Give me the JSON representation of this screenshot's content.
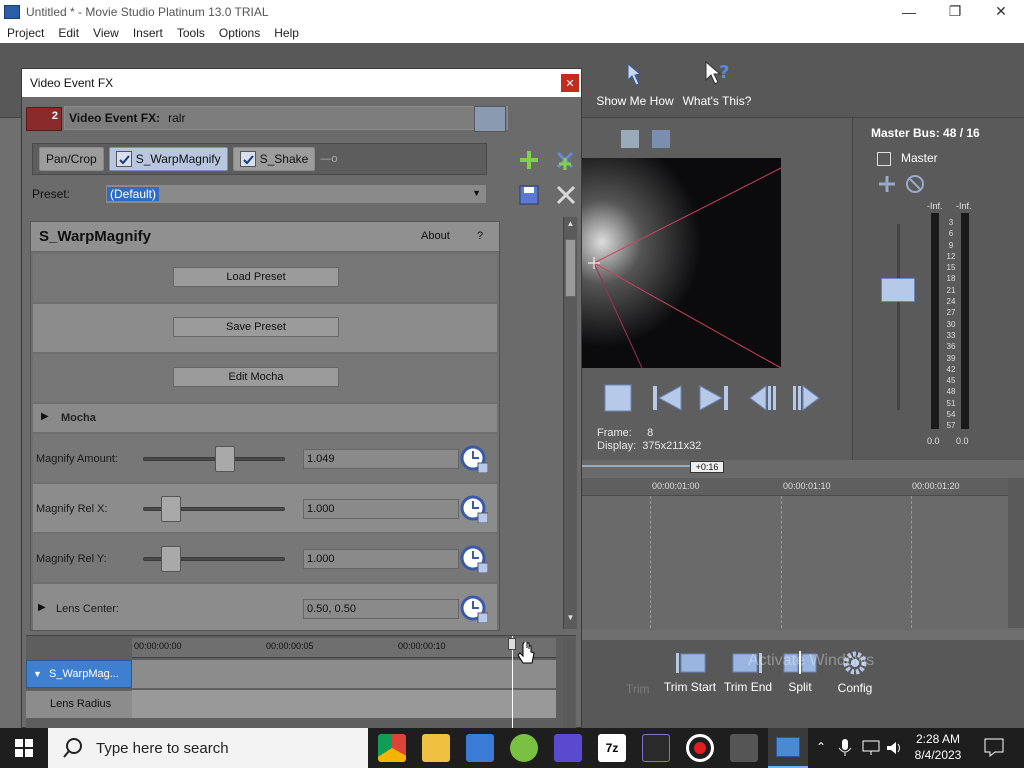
{
  "window": {
    "title": "Untitled * - Movie Studio Platinum 13.0 TRIAL"
  },
  "menu": [
    "Project",
    "Edit",
    "View",
    "Insert",
    "Tools",
    "Options",
    "Help"
  ],
  "toolbar": {
    "show_me_how": "Show Me How",
    "whats_this": "What's This?"
  },
  "preview": {
    "frame_label": "Frame:",
    "frame_value": "8",
    "display_label": "Display:",
    "display_value": "375x211x32"
  },
  "master": {
    "title": "Master Bus:",
    "counts": "48 / 16",
    "label": "Master",
    "peak_left": "-Inf.",
    "peak_right": "-Inf.",
    "scale": [
      "3",
      "6",
      "9",
      "12",
      "15",
      "18",
      "21",
      "24",
      "27",
      "30",
      "33",
      "36",
      "39",
      "42",
      "45",
      "48",
      "51",
      "54",
      "57"
    ],
    "floor_left": "0.0",
    "floor_right": "0.0"
  },
  "timeline": {
    "offset": "+0:16",
    "marks": [
      "00:00:01:00",
      "00:00:01:10",
      "00:00:01:20"
    ]
  },
  "dialog": {
    "title": "Video Event FX",
    "badge": "2",
    "header_label": "Video Event FX:",
    "header_value": "ralr",
    "chain": [
      "Pan/Crop",
      "S_WarpMagnify",
      "S_Shake"
    ],
    "preset_label": "Preset:",
    "preset_value": "(Default)",
    "plugin_name": "S_WarpMagnify",
    "about": "About",
    "help": "?",
    "buttons": [
      "Load Preset",
      "Save Preset",
      "Edit Mocha"
    ],
    "mocha": "Mocha",
    "params": [
      {
        "label": "Magnify Amount:",
        "value": "1.049",
        "slider": 0.58
      },
      {
        "label": "Magnify Rel X:",
        "value": "1.000",
        "slider": 0.2
      },
      {
        "label": "Magnify Rel Y:",
        "value": "1.000",
        "slider": 0.2
      }
    ],
    "lens_center_label": "Lens Center:",
    "lens_center_value": "0.50, 0.50",
    "kf_ruler": [
      "00:00:00:00",
      "00:00:00:05",
      "00:00:00:10"
    ],
    "kf_tracks": [
      "S_WarpMag...",
      "Lens Radius"
    ]
  },
  "bottom_tools": {
    "trim_start": "Trim Start",
    "trim_end": "Trim End",
    "split": "Split",
    "config": "Config",
    "trim": "Trim",
    "watermark": "Activate Windows"
  },
  "taskbar": {
    "search_placeholder": "Type here to search",
    "time": "2:28 AM",
    "date": "8/4/2023"
  }
}
